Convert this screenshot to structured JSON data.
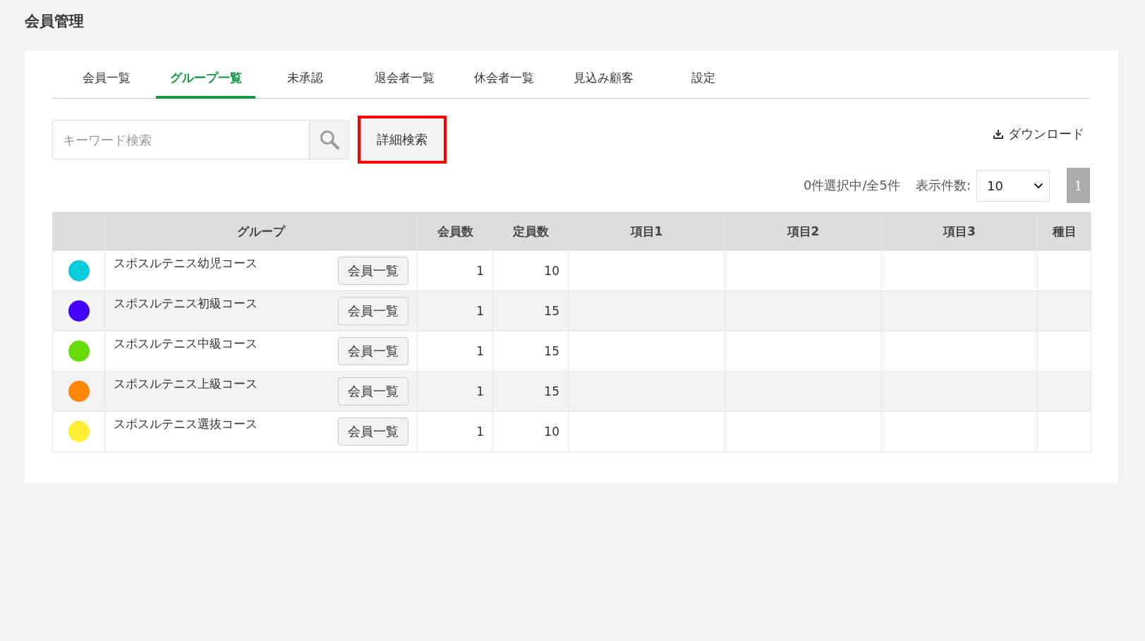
{
  "page_title": "会員管理",
  "tabs": [
    {
      "label": "会員一覧",
      "selected": false
    },
    {
      "label": "グループ一覧",
      "selected": true
    },
    {
      "label": "未承認",
      "selected": false
    },
    {
      "label": "退会者一覧",
      "selected": false
    },
    {
      "label": "休会者一覧",
      "selected": false
    },
    {
      "label": "見込み顧客",
      "selected": false
    },
    {
      "label": "設定",
      "selected": false
    }
  ],
  "search": {
    "placeholder": "キーワード検索"
  },
  "advanced_search_button": {
    "label": "詳細検索",
    "highlighted": true
  },
  "download_link": "ダウンロード",
  "selection_count": "0件選択中/全5件",
  "page_size": {
    "label": "表示件数:",
    "value": "10"
  },
  "pagination": [
    {
      "label": "1",
      "selected": true
    }
  ],
  "table": {
    "columns": [
      "",
      "グループ",
      "会員数",
      "定員数",
      "項目1",
      "項目2",
      "項目3",
      "種目"
    ],
    "rows": [
      {
        "color": "#00ccdd",
        "group": "スポスルテニス幼児コース",
        "button": "会員一覧",
        "members": "1",
        "capacity": "10"
      },
      {
        "color": "#4400ff",
        "group": "スポスルテニス初級コース",
        "button": "会員一覧",
        "members": "1",
        "capacity": "15"
      },
      {
        "color": "#66dd00",
        "group": "スポスルテニス中級コース",
        "button": "会員一覧",
        "members": "1",
        "capacity": "15"
      },
      {
        "color": "#ff8800",
        "group": "スポスルテニス上級コース",
        "button": "会員一覧",
        "members": "1",
        "capacity": "15"
      },
      {
        "color": "#ffee33",
        "group": "スポスルテニス選抜コース",
        "button": "会員一覧",
        "members": "1",
        "capacity": "10"
      }
    ]
  }
}
